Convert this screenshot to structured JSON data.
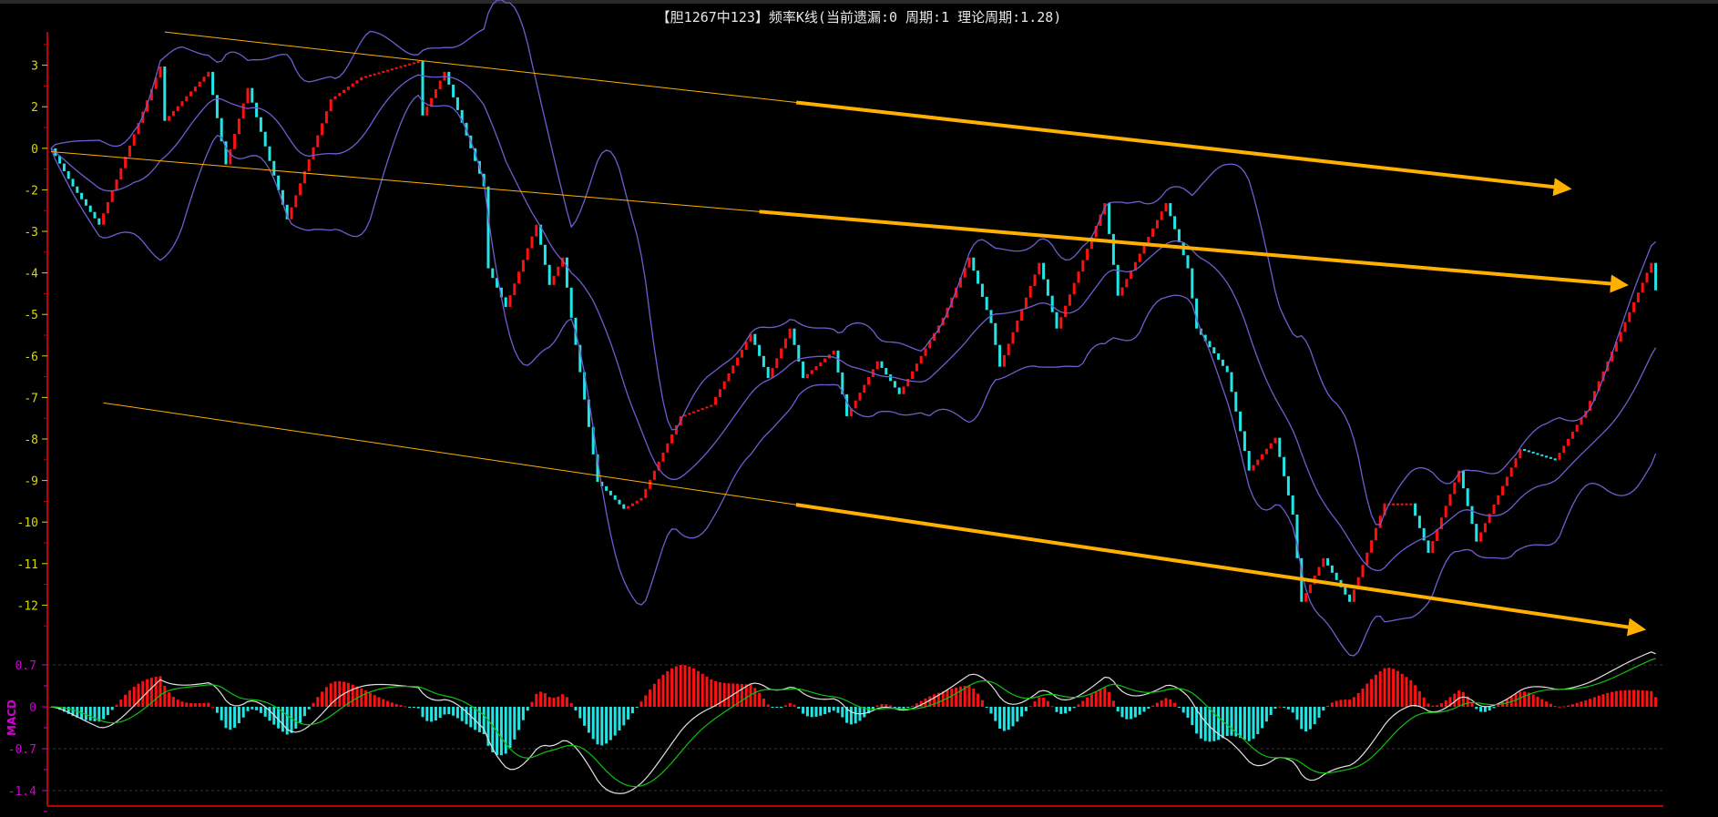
{
  "chart_data": {
    "type": "candlestick",
    "title": "【胆1267中123】频率K线(当前遗漏:0 周期:1 理论周期:1.28)",
    "y_ticks": [
      {
        "value": 3,
        "label": "3"
      },
      {
        "value": 2,
        "label": "2"
      },
      {
        "value": 1,
        "label": "0"
      },
      {
        "value": 0,
        "label": "-2"
      },
      {
        "value": -1,
        "label": "-3"
      },
      {
        "value": -2,
        "label": "-4"
      },
      {
        "value": -3,
        "label": "-5"
      },
      {
        "value": -4,
        "label": "-6"
      },
      {
        "value": -5,
        "label": "-7"
      },
      {
        "value": -6,
        "label": "-8"
      },
      {
        "value": -7,
        "label": "-9"
      },
      {
        "value": -8,
        "label": "-10"
      },
      {
        "value": -9,
        "label": "-11"
      },
      {
        "value": -10,
        "label": "-12"
      }
    ],
    "ylim": [
      -10.7,
      3.7
    ],
    "bar_count": 368,
    "close_waypoints": [
      [
        0,
        1.0
      ],
      [
        5,
        0.08
      ],
      [
        11,
        -0.84
      ],
      [
        25,
        2.97
      ],
      [
        26,
        1.66
      ],
      [
        36,
        2.84
      ],
      [
        40,
        0.61
      ],
      [
        45,
        2.45
      ],
      [
        54,
        -0.71
      ],
      [
        64,
        2.18
      ],
      [
        71,
        2.71
      ],
      [
        84,
        3.1
      ],
      [
        85,
        1.79
      ],
      [
        90,
        2.84
      ],
      [
        99,
        0.08
      ],
      [
        100,
        -1.89
      ],
      [
        104,
        -2.82
      ],
      [
        111,
        -0.84
      ],
      [
        114,
        -2.29
      ],
      [
        117,
        -1.63
      ],
      [
        119,
        -3.08
      ],
      [
        121,
        -4.39
      ],
      [
        125,
        -7.03
      ],
      [
        131,
        -7.68
      ],
      [
        135,
        -7.42
      ],
      [
        144,
        -5.45
      ],
      [
        151,
        -5.18
      ],
      [
        160,
        -3.47
      ],
      [
        164,
        -4.53
      ],
      [
        169,
        -3.34
      ],
      [
        172,
        -4.53
      ],
      [
        179,
        -3.87
      ],
      [
        182,
        -5.45
      ],
      [
        189,
        -4.13
      ],
      [
        194,
        -4.92
      ],
      [
        204,
        -3.08
      ],
      [
        210,
        -1.63
      ],
      [
        215,
        -3.21
      ],
      [
        217,
        -4.26
      ],
      [
        226,
        -1.76
      ],
      [
        230,
        -3.34
      ],
      [
        241,
        -0.32
      ],
      [
        244,
        -2.55
      ],
      [
        255,
        -0.32
      ],
      [
        260,
        -1.89
      ],
      [
        262,
        -3.34
      ],
      [
        269,
        -4.39
      ],
      [
        274,
        -6.76
      ],
      [
        280,
        -5.97
      ],
      [
        284,
        -7.82
      ],
      [
        286,
        -9.92
      ],
      [
        291,
        -8.87
      ],
      [
        297,
        -9.92
      ],
      [
        305,
        -7.55
      ],
      [
        311,
        -7.55
      ],
      [
        315,
        -8.74
      ],
      [
        322,
        -6.76
      ],
      [
        326,
        -8.47
      ],
      [
        336,
        -6.24
      ],
      [
        344,
        -6.5
      ],
      [
        351,
        -5.32
      ],
      [
        366,
        -1.76
      ],
      [
        367,
        -2.42
      ]
    ],
    "bollinger": {
      "period": 20,
      "k": 2
    },
    "trend_lines": [
      {
        "from": [
          26,
          3.8
        ],
        "to": [
          347,
          0.03
        ],
        "arrow": true
      },
      {
        "from": [
          0,
          0.92
        ],
        "to": [
          360,
          -2.29
        ],
        "arrow": true
      },
      {
        "from": [
          12,
          -5.13
        ],
        "to": [
          364,
          -10.58
        ],
        "arrow": true
      }
    ],
    "macd": {
      "label": "MACD",
      "fast": 12,
      "slow": 26,
      "signal": 9,
      "y_ticks": [
        {
          "value": 0.7,
          "label": "0.7"
        },
        {
          "value": 0,
          "label": "0"
        },
        {
          "value": -0.7,
          "label": "-0.7"
        },
        {
          "value": -1.4,
          "label": "-1.4"
        }
      ],
      "ylim": [
        -1.6,
        1.0
      ]
    },
    "colors": {
      "up": "#ff1010",
      "down": "#22e6e6",
      "band": "#6a5fd0",
      "trend": "#ffb000",
      "dif": "#e0e0e0",
      "dea": "#10c010",
      "axis": "#c00000",
      "ytick": "#d8d800",
      "macd_tick": "#d000d0"
    }
  }
}
